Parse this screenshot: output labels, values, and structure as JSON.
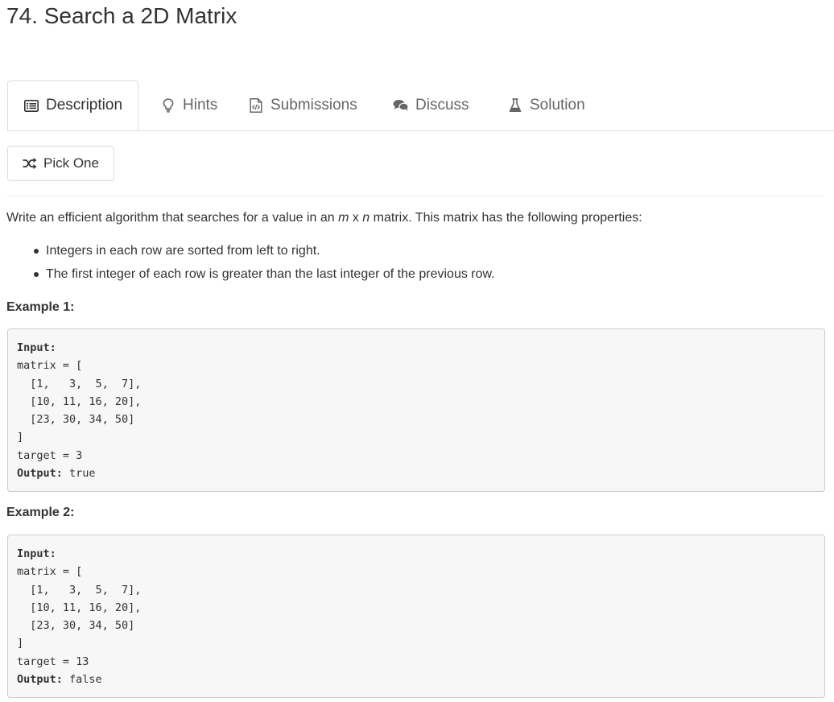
{
  "problem": {
    "title": "74. Search a 2D Matrix"
  },
  "tabs": [
    {
      "label": "Description",
      "icon": "list-icon",
      "active": true
    },
    {
      "label": "Hints",
      "icon": "lightbulb-icon",
      "active": false
    },
    {
      "label": "Submissions",
      "icon": "code-file-icon",
      "active": false
    },
    {
      "label": "Discuss",
      "icon": "comments-icon",
      "active": false
    },
    {
      "label": "Solution",
      "icon": "flask-icon",
      "active": false
    }
  ],
  "pick_button": {
    "label": "Pick One",
    "icon": "shuffle-icon"
  },
  "description": {
    "intro_before": "Write an efficient algorithm that searches for a value in an ",
    "m": "m",
    "x": " x ",
    "n": "n",
    "intro_after": " matrix. This matrix has the following properties:",
    "properties": [
      "Integers in each row are sorted from left to right.",
      "The first integer of each row is greater than the last integer of the previous row."
    ]
  },
  "examples": [
    {
      "heading": "Example 1:",
      "input_label": "Input:",
      "lines": [
        "matrix = [",
        "  [1,   3,  5,  7],",
        "  [10, 11, 16, 20],",
        "  [23, 30, 34, 50]",
        "]",
        "target = 3"
      ],
      "output_label": "Output:",
      "output_value": " true"
    },
    {
      "heading": "Example 2:",
      "input_label": "Input:",
      "lines": [
        "matrix = [",
        "  [1,   3,  5,  7],",
        "  [10, 11, 16, 20],",
        "  [23, 30, 34, 50]",
        "]",
        "target = 13"
      ],
      "output_label": "Output:",
      "output_value": " false"
    }
  ]
}
